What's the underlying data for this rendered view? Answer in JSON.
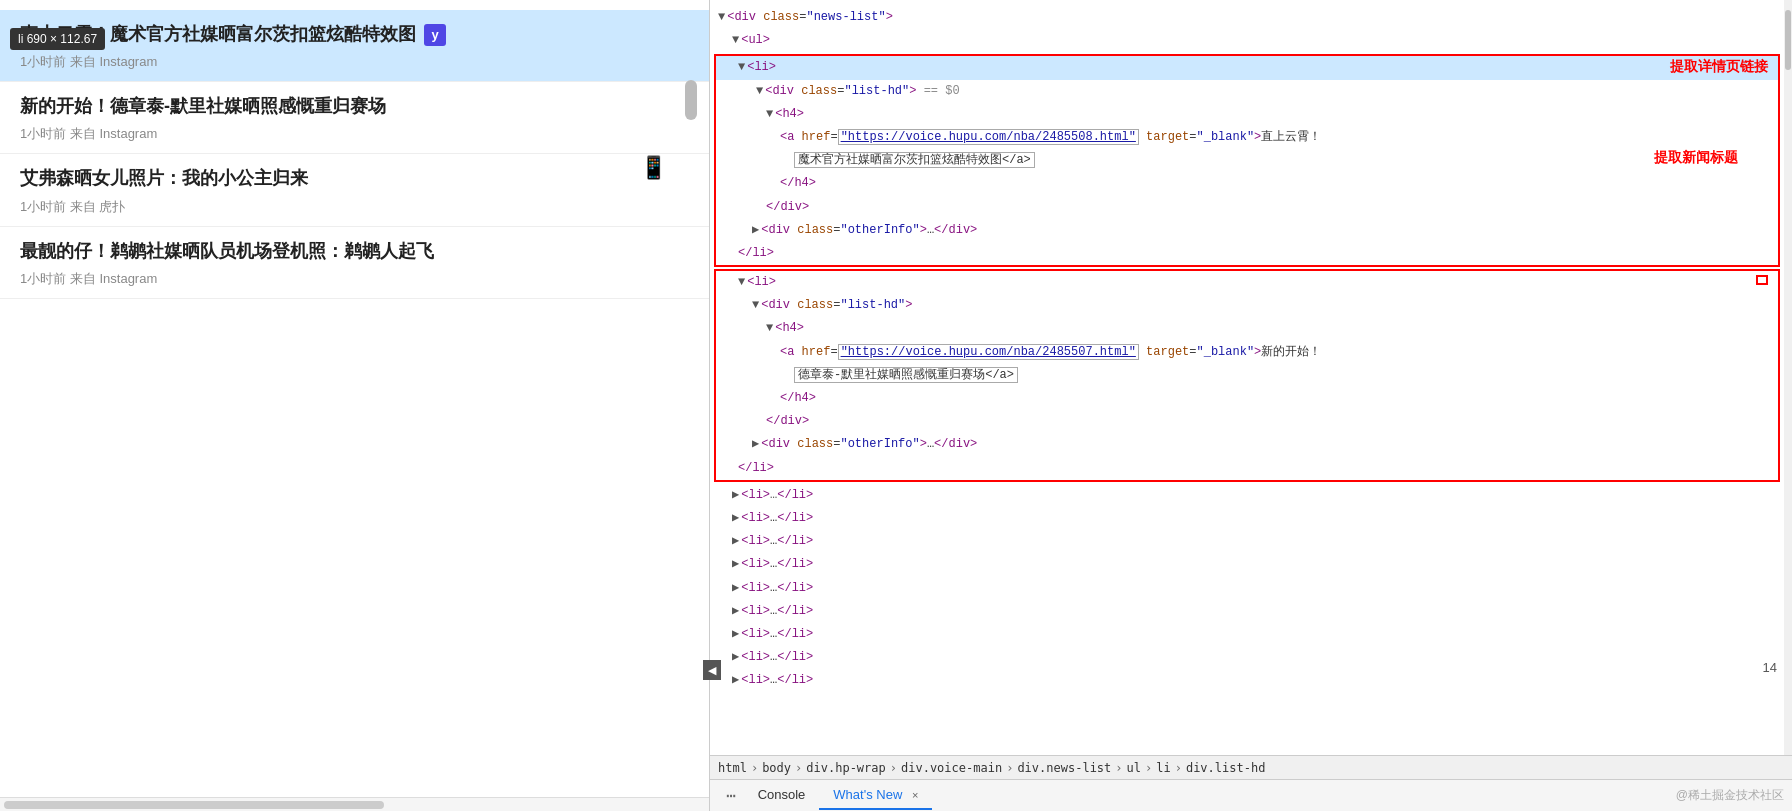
{
  "tooltip": {
    "text": "li  690 × 112.67"
  },
  "news": {
    "items": [
      {
        "title": "直上云霄！魔术官方社媒晒富尔茨扣篮炫酷特效图",
        "meta": "1小时前 来自 Instagram",
        "highlighted": true,
        "hasLogo": true
      },
      {
        "title": "新的开始！德章泰-默里社媒晒照感慨重归赛场",
        "meta": "1小时前 来自 Instagram",
        "highlighted": false,
        "hasLogo": false
      },
      {
        "title": "艾弗森晒女儿照片：我的小公主归来",
        "meta": "1小时前 来自 虎扑",
        "highlighted": false,
        "hasLogo": false
      },
      {
        "title": "最靓的仔！鹈鹕社媒晒队员机场登机照：鹈鹕人起飞",
        "meta": "1小时前 来自 Instagram",
        "highlighted": false,
        "hasLogo": false
      }
    ]
  },
  "devtools": {
    "tree": {
      "lines": [
        {
          "indent": 0,
          "content": "▼ <div class=\"news-list\">",
          "type": "tag"
        },
        {
          "indent": 1,
          "content": "▼ <ul>",
          "type": "tag"
        }
      ]
    },
    "section1": {
      "lines": [
        {
          "indent": 1,
          "content": "▼ <li>",
          "selected": true
        },
        {
          "indent": 2,
          "content": "▼ <div class=\"list-hd\"> == $0"
        },
        {
          "indent": 3,
          "content": "▼ <h4>"
        },
        {
          "indent": 4,
          "content_parts": [
            "<a href=\"",
            "https://voice.hupu.com/nba/2485508.html",
            "\" target=\"_blank\">直上云霄！",
            "url"
          ]
        },
        {
          "indent": 5,
          "content": "魔术官方社媒晒富尔茨扣篮炫酷特效图</a>",
          "type": "text_highlight"
        },
        {
          "indent": 4,
          "content": "</h4>"
        },
        {
          "indent": 3,
          "content": "</div>"
        },
        {
          "indent": 2,
          "content": "▶ <div class=\"otherInfo\">…</div>"
        },
        {
          "indent": 1,
          "content": "</li>"
        }
      ],
      "annotation_url": "提取详情页链接",
      "annotation_title": "提取新闻标题",
      "url": "https://voice.hupu.com/nba/2485508.html",
      "text": "魔术官方社媒晒富尔茨扣篮炫酷特效图</a>"
    },
    "section2": {
      "lines": [
        {
          "indent": 1,
          "content": "▼ <li>"
        },
        {
          "indent": 2,
          "content": "▼ <div class=\"list-hd\">"
        },
        {
          "indent": 3,
          "content": "▼ <h4>"
        },
        {
          "indent": 4,
          "content_parts": [
            "<a href=\"",
            "https://voice.hupu.com/nba/2485507.html",
            "\" target=\"_blank\">新的开始！",
            "url"
          ]
        },
        {
          "indent": 5,
          "content": "德章泰-默里社媒晒照感慨重归赛场</a>",
          "type": "text_highlight"
        },
        {
          "indent": 4,
          "content": "</h4>"
        },
        {
          "indent": 3,
          "content": "</div>"
        },
        {
          "indent": 2,
          "content": "▶ <div class=\"otherInfo\">…</div>"
        },
        {
          "indent": 1,
          "content": "</li>"
        }
      ],
      "url": "https://voice.hupu.com/nba/2485507.html",
      "text": "德章泰-默里社媒晒照感慨重归赛场</a>"
    },
    "collapsed_items": [
      "▶ <li>…</li>",
      "▶ <li>…</li>",
      "▶ <li>…</li>",
      "▶ <li>…</li>",
      "▶ <li>…</li>",
      "▶ <li>…</li>",
      "▶ <li>…</li>",
      "▶ <li>…</li>"
    ]
  },
  "breadcrumb": {
    "items": [
      "html",
      "body",
      "div.hp-wrap",
      "div.voice-main",
      "div.news-list",
      "ul",
      "li",
      "div.list-hd"
    ]
  },
  "tabs": {
    "items": [
      {
        "label": "Console",
        "active": false
      },
      {
        "label": "What's New",
        "active": true,
        "closeable": true
      }
    ],
    "three_dots": "⋮"
  },
  "watermark": "@稀土掘金技术社区",
  "page_number": "14"
}
